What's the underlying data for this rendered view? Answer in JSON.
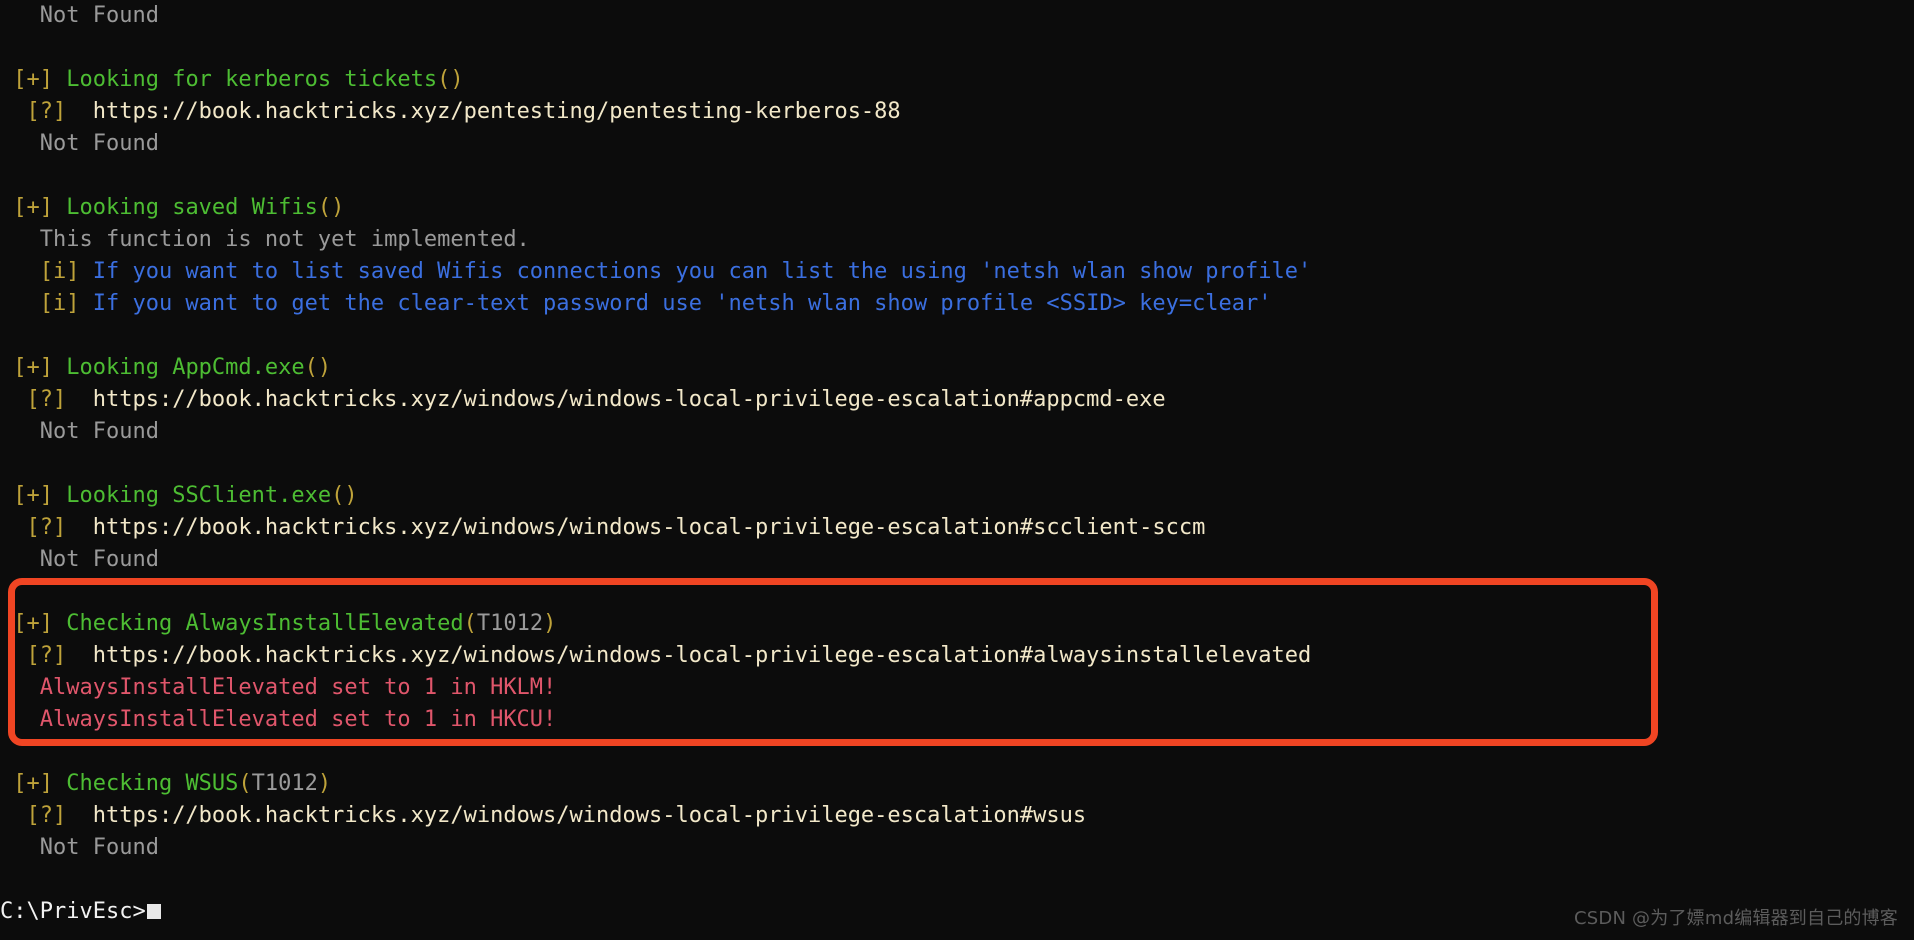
{
  "terminal": {
    "background_color": "#0c0c0c",
    "prompt": {
      "text": "C:\\PrivEsc>",
      "cursor": "block"
    },
    "colors": {
      "grey": "#9a9a9a",
      "yellow": "#bfa33a",
      "green": "#4dbd33",
      "cream": "#f2e8c9",
      "blue": "#3b6fe0",
      "pink": "#e0566b",
      "white": "#f2f2f2",
      "highlight_red": "#f04523"
    },
    "lines": [
      {
        "id": "l0",
        "segments": [
          {
            "text": "   Not Found",
            "color": "grey"
          }
        ]
      },
      {
        "id": "l1",
        "segments": [
          {
            "text": "",
            "color": "grey"
          }
        ]
      },
      {
        "id": "l2",
        "segments": [
          {
            "text": " [+] ",
            "color": "yellow"
          },
          {
            "text": "Looking for kerberos tickets",
            "color": "green"
          },
          {
            "text": "()",
            "color": "yellow"
          }
        ]
      },
      {
        "id": "l3",
        "segments": [
          {
            "text": "  [?]  ",
            "color": "yellow"
          },
          {
            "text": "https://book.hacktricks.xyz/pentesting/pentesting-kerberos-88",
            "color": "cream"
          }
        ]
      },
      {
        "id": "l4",
        "segments": [
          {
            "text": "   Not Found",
            "color": "grey"
          }
        ]
      },
      {
        "id": "l5",
        "segments": [
          {
            "text": "",
            "color": "grey"
          }
        ]
      },
      {
        "id": "l6",
        "segments": [
          {
            "text": " [+] ",
            "color": "yellow"
          },
          {
            "text": "Looking saved Wifis",
            "color": "green"
          },
          {
            "text": "()",
            "color": "yellow"
          }
        ]
      },
      {
        "id": "l7",
        "segments": [
          {
            "text": "   This function is not yet implemented.",
            "color": "grey"
          }
        ]
      },
      {
        "id": "l8",
        "segments": [
          {
            "text": "   [i] ",
            "color": "yellow"
          },
          {
            "text": "If you want to list saved Wifis connections you can list the using 'netsh wlan show profile'",
            "color": "blue"
          }
        ]
      },
      {
        "id": "l9",
        "segments": [
          {
            "text": "   [i] ",
            "color": "yellow"
          },
          {
            "text": "If you want to get the clear-text password use 'netsh wlan show profile <SSID> key=clear'",
            "color": "blue"
          }
        ]
      },
      {
        "id": "l10",
        "segments": [
          {
            "text": "",
            "color": "grey"
          }
        ]
      },
      {
        "id": "l11",
        "segments": [
          {
            "text": " [+] ",
            "color": "yellow"
          },
          {
            "text": "Looking AppCmd.exe",
            "color": "green"
          },
          {
            "text": "()",
            "color": "yellow"
          }
        ]
      },
      {
        "id": "l12",
        "segments": [
          {
            "text": "  [?]  ",
            "color": "yellow"
          },
          {
            "text": "https://book.hacktricks.xyz/windows/windows-local-privilege-escalation#appcmd-exe",
            "color": "cream"
          }
        ]
      },
      {
        "id": "l13",
        "segments": [
          {
            "text": "   Not Found",
            "color": "grey"
          }
        ]
      },
      {
        "id": "l14",
        "segments": [
          {
            "text": "",
            "color": "grey"
          }
        ]
      },
      {
        "id": "l15",
        "segments": [
          {
            "text": " [+] ",
            "color": "yellow"
          },
          {
            "text": "Looking SSClient.exe",
            "color": "green"
          },
          {
            "text": "()",
            "color": "yellow"
          }
        ]
      },
      {
        "id": "l16",
        "segments": [
          {
            "text": "  [?]  ",
            "color": "yellow"
          },
          {
            "text": "https://book.hacktricks.xyz/windows/windows-local-privilege-escalation#scclient-sccm",
            "color": "cream"
          }
        ]
      },
      {
        "id": "l17",
        "segments": [
          {
            "text": "   Not Found",
            "color": "grey"
          }
        ]
      },
      {
        "id": "l18",
        "segments": [
          {
            "text": "",
            "color": "grey"
          }
        ]
      },
      {
        "id": "l19",
        "segments": [
          {
            "text": " [+] ",
            "color": "yellow"
          },
          {
            "text": "Checking AlwaysInstallElevated",
            "color": "green"
          },
          {
            "text": "(",
            "color": "yellow"
          },
          {
            "text": "T1012",
            "color": "grey"
          },
          {
            "text": ")",
            "color": "yellow"
          }
        ]
      },
      {
        "id": "l20",
        "segments": [
          {
            "text": "  [?]  ",
            "color": "yellow"
          },
          {
            "text": "https://book.hacktricks.xyz/windows/windows-local-privilege-escalation#alwaysinstallelevated",
            "color": "cream"
          }
        ]
      },
      {
        "id": "l21",
        "segments": [
          {
            "text": "   AlwaysInstallElevated set to 1 in HKLM!",
            "color": "pink"
          }
        ]
      },
      {
        "id": "l22",
        "segments": [
          {
            "text": "   AlwaysInstallElevated set to 1 in HKCU!",
            "color": "pink"
          }
        ]
      },
      {
        "id": "l23",
        "segments": [
          {
            "text": "",
            "color": "grey"
          }
        ]
      },
      {
        "id": "l24",
        "segments": [
          {
            "text": " [+] ",
            "color": "yellow"
          },
          {
            "text": "Checking WSUS",
            "color": "green"
          },
          {
            "text": "(",
            "color": "yellow"
          },
          {
            "text": "T1012",
            "color": "grey"
          },
          {
            "text": ")",
            "color": "yellow"
          }
        ]
      },
      {
        "id": "l25",
        "segments": [
          {
            "text": "  [?]  ",
            "color": "yellow"
          },
          {
            "text": "https://book.hacktricks.xyz/windows/windows-local-privilege-escalation#wsus",
            "color": "cream"
          }
        ]
      },
      {
        "id": "l26",
        "segments": [
          {
            "text": "   Not Found",
            "color": "grey"
          }
        ]
      },
      {
        "id": "l27",
        "segments": [
          {
            "text": "",
            "color": "grey"
          }
        ]
      },
      {
        "id": "l28",
        "segments": [
          {
            "text": "C:\\PrivEsc>",
            "color": "white",
            "cursor": true
          }
        ]
      }
    ]
  },
  "highlight": {
    "label": "alwaysinstallelevated-finding-highlight",
    "color": "#f04523"
  },
  "watermark": {
    "text": "CSDN @为了嫖md编辑器到自己的博客"
  }
}
